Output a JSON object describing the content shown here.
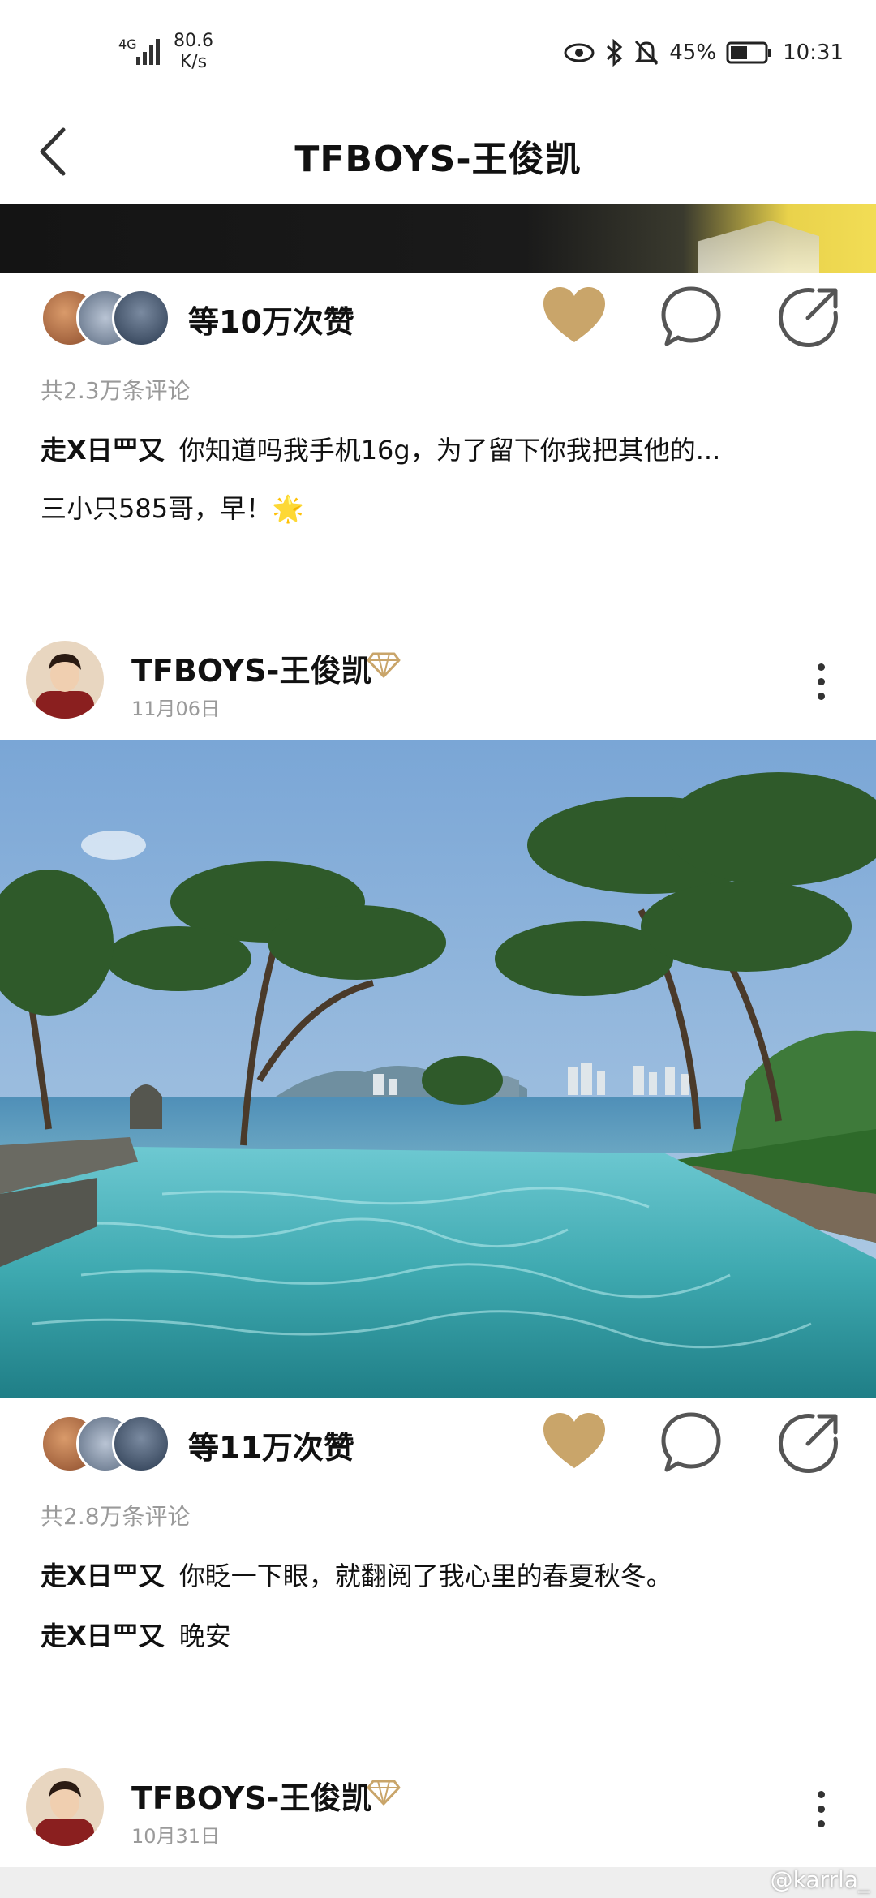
{
  "status_bar": {
    "network_type": "4G",
    "speed_value": "80.6",
    "speed_unit": "K/s",
    "battery": "45%",
    "time": "10:31",
    "icons": [
      "signal-icon",
      "eye-icon",
      "bluetooth-icon",
      "bell-off-icon",
      "battery-icon"
    ]
  },
  "header": {
    "title": "TFBOYS-王俊凯",
    "back_icon": "chevron-left-icon"
  },
  "posts": [
    {
      "likes_text": "等10万次赞",
      "comments_count": "共2.3万条评论",
      "comments": [
        {
          "user": "走X日罒又",
          "text": "你知道吗我手机16g，为了留下你我把其他的..."
        },
        {
          "user": "",
          "text": "三小只585哥，早！🌟"
        }
      ]
    },
    {
      "author": "TFBOYS-王俊凯",
      "date": "11月06日",
      "image": "tropical-infinity-pool-photo",
      "likes_text": "等11万次赞",
      "comments_count": "共2.8万条评论",
      "comments": [
        {
          "user": "走X日罒又",
          "text": "你眨一下眼，就翻阅了我心里的春夏秋冬。"
        },
        {
          "user": "走X日罒又",
          "text": "晚安"
        }
      ]
    },
    {
      "author": "TFBOYS-王俊凯",
      "date": "10月31日"
    }
  ],
  "watermark": "@karrla_",
  "colors": {
    "accent_gold": "#C9A56A",
    "icon_gray": "#555555",
    "muted_text": "#9A9A9A"
  }
}
